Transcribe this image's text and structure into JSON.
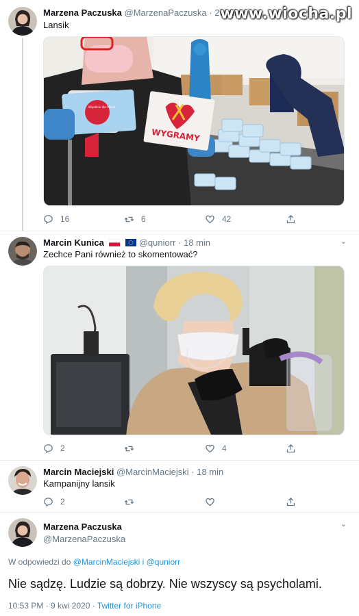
{
  "watermark": "www.wiocha.pl",
  "tweets": [
    {
      "name": "Marzena Paczuska",
      "handle": "@MarzenaPaczuska",
      "sep": "·",
      "time": "26 min",
      "text": "Lansik",
      "media_text_1": "Wspólnie dla Ciebie",
      "media_text_2": "WYGRAMY",
      "replies": "16",
      "retweets": "6",
      "likes": "42"
    },
    {
      "name": "Marcin Kunica",
      "handle": "@quniorr",
      "sep": "·",
      "time": "18 min",
      "text": "Zechce Pani również to skomentować?",
      "replies": "2",
      "retweets": "",
      "likes": "4"
    },
    {
      "name": "Marcin Maciejski",
      "handle": "@MarcinMaciejski",
      "sep": "·",
      "time": "18 min",
      "text": "Kampanijny lansik",
      "replies": "2",
      "retweets": "",
      "likes": ""
    }
  ],
  "main_tweet": {
    "name": "Marzena Paczuska",
    "handle": "@MarzenaPaczuska",
    "reply_prefix": "W odpowiedzi do",
    "reply_users": "@MarcinMaciejski i @quniorr",
    "text": "Nie sądzę. Ludzie są dobrzy. Nie wszyscy są psycholami.",
    "timestamp": "10:53 PM · 9 kwi 2020 · ",
    "source": "Twitter for iPhone"
  },
  "icons": {
    "reply": "reply-icon",
    "retweet": "retweet-icon",
    "like": "heart-icon",
    "share": "share-icon",
    "caret": "chevron-down-icon"
  },
  "colors": {
    "link": "#1b95e0",
    "secondary": "#657786",
    "text": "#14171a"
  }
}
